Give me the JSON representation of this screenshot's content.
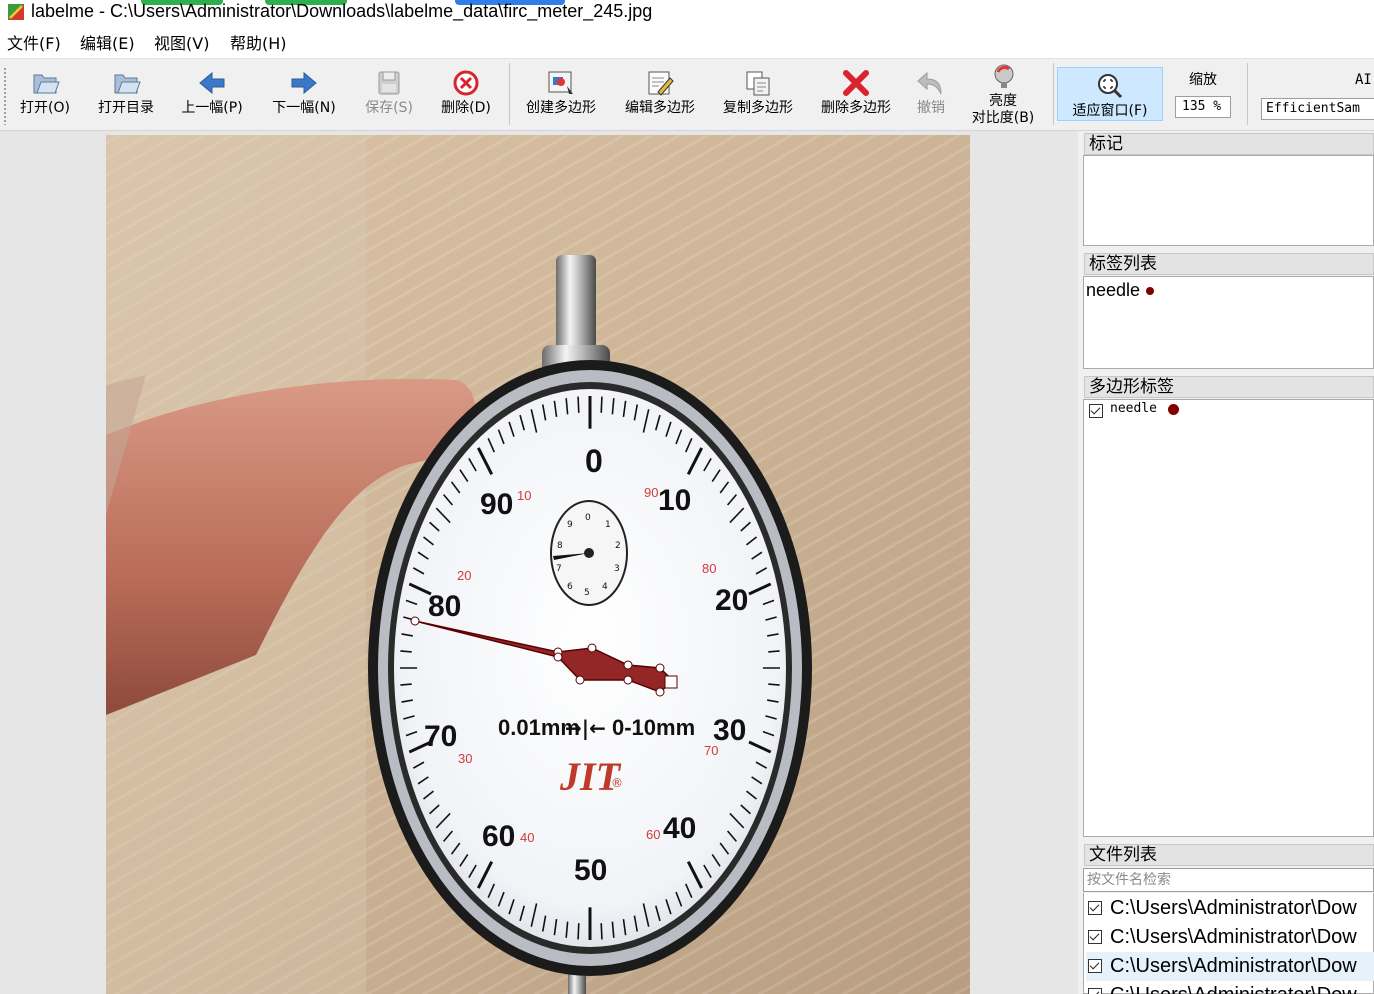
{
  "window": {
    "title": "labelme - C:\\Users\\Administrator\\Downloads\\labelme_data\\firc_meter_245.jpg"
  },
  "menu": [
    "文件(F)",
    "编辑(E)",
    "视图(V)",
    "帮助(H)"
  ],
  "toolbar": {
    "open": "打开(O)",
    "open_dir": "打开目录",
    "prev": "上一幅(P)",
    "next": "下一幅(N)",
    "save": "保存(S)",
    "delete": "删除(D)",
    "create_polygon": "创建多边形",
    "edit_polygon": "编辑多边形",
    "copy_polygon": "复制多边形",
    "delete_polygon": "删除多边形",
    "undo": "撤销",
    "brightness_line1": "亮度",
    "brightness_line2": "对比度(B)",
    "fit_window": "适应窗口(F)",
    "zoom_label": "缩放",
    "zoom_value": "135 %",
    "ai_label": "AI",
    "ai_model": "EfficientSam"
  },
  "dial": {
    "major_labels": [
      "0",
      "10",
      "20",
      "30",
      "40",
      "50",
      "60",
      "70",
      "80",
      "90"
    ],
    "minor_labels": [
      "10",
      "20",
      "30",
      "40",
      "60",
      "70",
      "80",
      "90"
    ],
    "small_dial_labels": [
      "0",
      "1",
      "2",
      "3",
      "4",
      "5",
      "6",
      "7",
      "8",
      "9"
    ],
    "spec_left": "0.01mm",
    "spec_arrows": "→|←",
    "spec_right": "0-10mm",
    "brand": "JIT",
    "registered_mark": "®"
  },
  "panels": {
    "flags_title": "标记",
    "labels_title": "标签列表",
    "polygons_title": "多边形标签",
    "files_title": "文件列表"
  },
  "labels": [
    {
      "name": "needle",
      "color": "#800000"
    }
  ],
  "polygons": [
    {
      "name": "needle",
      "checked": true,
      "color": "#800000"
    }
  ],
  "file_search": {
    "placeholder": "按文件名检索"
  },
  "files": [
    {
      "path": "C:\\Users\\Administrator\\Dow",
      "checked": true,
      "selected": false
    },
    {
      "path": "C:\\Users\\Administrator\\Dow",
      "checked": true,
      "selected": false
    },
    {
      "path": "C:\\Users\\Administrator\\Dow",
      "checked": true,
      "selected": true
    },
    {
      "path": "C:\\Users\\Administrator\\Dow",
      "checked": true,
      "selected": false
    }
  ],
  "colors": {
    "accent": "#cde8ff",
    "shape": "#800000"
  }
}
